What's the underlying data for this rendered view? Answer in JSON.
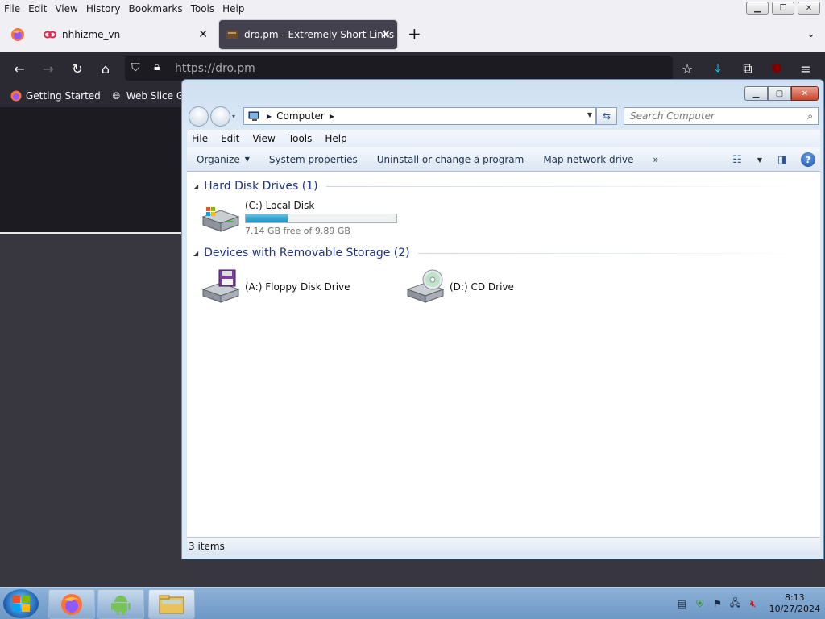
{
  "firefox": {
    "menu": [
      {
        "label": "File"
      },
      {
        "label": "Edit"
      },
      {
        "label": "View"
      },
      {
        "label": "History"
      },
      {
        "label": "Bookmarks"
      },
      {
        "label": "Tools"
      },
      {
        "label": "Help"
      }
    ],
    "tabs": [
      {
        "title": "nhhizme_vn",
        "icon": "link-icon"
      },
      {
        "title": "dro.pm - Extremely Short Links",
        "icon": "dro-favicon"
      }
    ],
    "url": "https://dro.pm",
    "bookmarks": [
      {
        "label": "Getting Started",
        "icon": "firefox-icon"
      },
      {
        "label": "Web Slice Galle",
        "icon": "globe-icon"
      }
    ]
  },
  "explorer": {
    "breadcrumb": "Computer",
    "search_placeholder": "Search Computer",
    "menu": [
      {
        "label": "File"
      },
      {
        "label": "Edit"
      },
      {
        "label": "View"
      },
      {
        "label": "Tools"
      },
      {
        "label": "Help"
      }
    ],
    "toolbar": {
      "organize": "Organize",
      "system_properties": "System properties",
      "uninstall": "Uninstall or change a program",
      "map_drive": "Map network drive",
      "more": "»"
    },
    "groups": {
      "hard_disks": "Hard Disk Drives (1)",
      "removable": "Devices with Removable Storage (2)"
    },
    "drives": {
      "c": {
        "label": "(C:) Local Disk",
        "free": "7.14 GB free of 9.89 GB",
        "used_fraction": 0.278
      },
      "a": {
        "label": "(A:) Floppy Disk Drive"
      },
      "d": {
        "label": "(D:) CD Drive"
      }
    },
    "status": "3 items"
  },
  "taskbar": {
    "time": "8:13",
    "date": "10/27/2024"
  },
  "colors": {
    "firefox_dark": "#2b2a33",
    "explorer_frame": "#dbe8f6",
    "progress_fill": "#1b8fc0",
    "taskbar": "#7ea6d0"
  }
}
